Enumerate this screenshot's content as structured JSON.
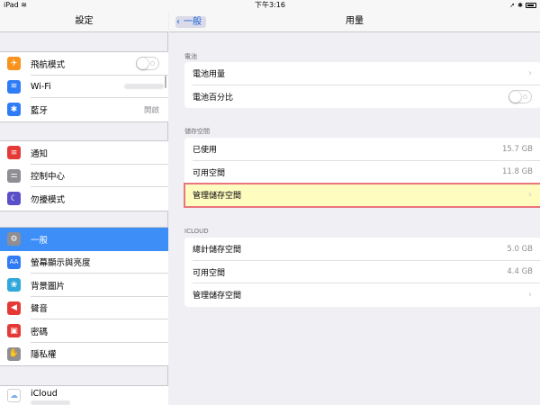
{
  "status_bar": {
    "device": "iPad",
    "time": "下午3:16"
  },
  "left": {
    "title": "設定",
    "groups": [
      [
        {
          "label": "飛航模式",
          "icon": "airplane-icon",
          "color": "#f7931e"
        },
        {
          "label": "Wi-Fi",
          "icon": "wifi-icon",
          "color": "#2f7cf6"
        },
        {
          "label": "藍牙",
          "icon": "bluetooth-icon",
          "color": "#2f7cf6",
          "detail": "開啟"
        }
      ],
      [
        {
          "label": "通知",
          "icon": "notifications-icon",
          "color": "#e53935"
        },
        {
          "label": "控制中心",
          "icon": "control-center-icon",
          "color": "#8e8e93"
        },
        {
          "label": "勿擾模式",
          "icon": "moon-icon",
          "color": "#5b4fc7"
        }
      ],
      [
        {
          "label": "一般",
          "icon": "gear-icon",
          "color": "#8e8e93"
        },
        {
          "label": "螢幕顯示與亮度",
          "icon": "display-icon",
          "color": "#2f7cf6"
        },
        {
          "label": "背景圖片",
          "icon": "wallpaper-icon",
          "color": "#30a8d9"
        },
        {
          "label": "聲音",
          "icon": "sound-icon",
          "color": "#e53935"
        },
        {
          "label": "密碼",
          "icon": "lock-icon",
          "color": "#e53935"
        },
        {
          "label": "隱私權",
          "icon": "hand-icon",
          "color": "#8e8e93"
        }
      ],
      [
        {
          "label": "iCloud",
          "icon": "icloud-icon",
          "color": "#ffffff"
        }
      ]
    ]
  },
  "right": {
    "title": "用量",
    "back_label": "一般",
    "sections": [
      {
        "header": "電池",
        "rows": [
          {
            "label": "電池用量",
            "chevron": "›"
          },
          {
            "label": "電池百分比"
          }
        ]
      },
      {
        "header": "儲存空間",
        "rows": [
          {
            "label": "已使用",
            "value": "15.7 GB"
          },
          {
            "label": "可用空間",
            "value": "11.8 GB"
          },
          {
            "label": "管理儲存空間",
            "chevron": "›"
          }
        ]
      },
      {
        "header": "ICLOUD",
        "rows": [
          {
            "label": "總計儲存空間",
            "value": "5.0 GB"
          },
          {
            "label": "可用空間",
            "value": "4.4 GB"
          },
          {
            "label": "管理儲存空間",
            "chevron": "›"
          }
        ]
      }
    ]
  }
}
